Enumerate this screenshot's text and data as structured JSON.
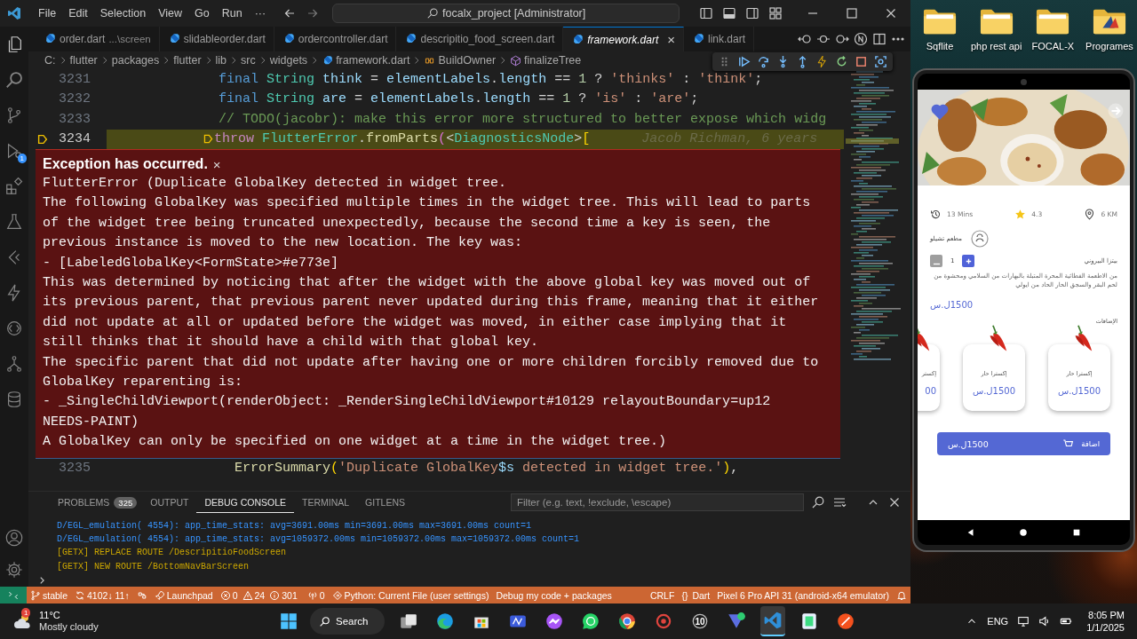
{
  "title_bar": {
    "menu": [
      "File",
      "Edit",
      "Selection",
      "View",
      "Go",
      "Run",
      "···"
    ],
    "command_center": "focalx_project [Administrator]"
  },
  "activity_bar": {
    "run_badge": "1"
  },
  "tabs": [
    {
      "label": "order.dart",
      "description": "...\\screen",
      "selected": false,
      "preview": false
    },
    {
      "label": "slidableorder.dart",
      "selected": false,
      "preview": false
    },
    {
      "label": "ordercontroller.dart",
      "selected": false,
      "preview": false
    },
    {
      "label": "descripitio_food_screen.dart",
      "selected": false,
      "preview": false
    },
    {
      "label": "framework.dart",
      "selected": true,
      "preview": true,
      "close": "×"
    },
    {
      "label": "link.dart",
      "selected": false,
      "preview": false
    }
  ],
  "breadcrumbs": [
    {
      "kind": "folder",
      "label": "C:"
    },
    {
      "kind": "folder",
      "label": "flutter"
    },
    {
      "kind": "folder",
      "label": "packages"
    },
    {
      "kind": "folder",
      "label": "flutter"
    },
    {
      "kind": "folder",
      "label": "lib"
    },
    {
      "kind": "folder",
      "label": "src"
    },
    {
      "kind": "folder",
      "label": "widgets"
    },
    {
      "kind": "file",
      "label": "framework.dart"
    },
    {
      "kind": "class",
      "label": "BuildOwner"
    },
    {
      "kind": "method",
      "label": "finalizeTree"
    }
  ],
  "editor": {
    "lines_before": [
      {
        "number": "3231",
        "current": false,
        "tokens": [
          {
            "kind": "kw",
            "text": "              final"
          },
          {
            "kind": "type",
            "text": " String"
          },
          {
            "kind": "var",
            "text": " think"
          },
          {
            "kind": "op",
            "text": " = "
          },
          {
            "kind": "var",
            "text": "elementLabels"
          },
          {
            "kind": "op",
            "text": "."
          },
          {
            "kind": "var",
            "text": "length"
          },
          {
            "kind": "op",
            "text": " == "
          },
          {
            "kind": "num",
            "text": "1"
          },
          {
            "kind": "op",
            "text": " ? "
          },
          {
            "kind": "str",
            "text": "'thinks'"
          },
          {
            "kind": "op",
            "text": " : "
          },
          {
            "kind": "str",
            "text": "'think'"
          },
          {
            "kind": "op",
            "text": ";"
          }
        ]
      },
      {
        "number": "3232",
        "current": false,
        "tokens": [
          {
            "kind": "kw",
            "text": "              final"
          },
          {
            "kind": "type",
            "text": " String"
          },
          {
            "kind": "var",
            "text": " are"
          },
          {
            "kind": "op",
            "text": " = "
          },
          {
            "kind": "var",
            "text": "elementLabels"
          },
          {
            "kind": "op",
            "text": "."
          },
          {
            "kind": "var",
            "text": "length"
          },
          {
            "kind": "op",
            "text": " == "
          },
          {
            "kind": "num",
            "text": "1"
          },
          {
            "kind": "op",
            "text": " ? "
          },
          {
            "kind": "str",
            "text": "'is'"
          },
          {
            "kind": "op",
            "text": " : "
          },
          {
            "kind": "str",
            "text": "'are'"
          },
          {
            "kind": "op",
            "text": ";"
          }
        ]
      },
      {
        "number": "3233",
        "current": false,
        "tokens": [
          {
            "kind": "comment",
            "text": "              // TODO(jacobr): make this error more structured to better expose which widg"
          }
        ]
      },
      {
        "number": "3234",
        "current": true,
        "blame": "Jacob Richman, 6 years",
        "tokens": [
          {
            "kind": "ctrl",
            "text": "            throw"
          },
          {
            "kind": "type",
            "text": " FlutterError"
          },
          {
            "kind": "op",
            "text": "."
          },
          {
            "kind": "fn",
            "text": "fromParts"
          },
          {
            "kind": "bracket2",
            "text": "("
          },
          {
            "kind": "op",
            "text": "<"
          },
          {
            "kind": "type",
            "text": "DiagnosticsNode"
          },
          {
            "kind": "op",
            "text": ">"
          },
          {
            "kind": "bracket",
            "text": "["
          }
        ]
      }
    ],
    "exception": {
      "title": "Exception has occurred.",
      "close": "×",
      "lines": [
        "FlutterError (Duplicate GlobalKey detected in widget tree.",
        "The following GlobalKey was specified multiple times in the widget tree. This will lead to parts",
        "of the widget tree being truncated unexpectedly, because the second time a key is seen, the",
        "previous instance is moved to the new location. The key was:",
        "- [LabeledGlobalKey<FormState>#e773e]",
        "This was determined by noticing that after the widget with the above global key was moved out of",
        "its previous parent, that previous parent never updated during this frame, meaning that it either",
        "did not update at all or updated before the widget was moved, in either case implying that it",
        "still thinks that it should have a child with that global key.",
        "The specific parent that did not update after having one or more children forcibly removed due to",
        "GlobalKey reparenting is:",
        "- _SingleChildViewport(renderObject: _RenderSingleChildViewport#10129 relayoutBoundary=up12",
        "NEEDS-PAINT)",
        "A GlobalKey can only be specified on one widget at a time in the widget tree.)"
      ]
    },
    "lines_after": [
      {
        "number": "3235",
        "current": false,
        "tokens": [
          {
            "kind": "fn",
            "text": "                ErrorSummary"
          },
          {
            "kind": "bracket",
            "text": "("
          },
          {
            "kind": "str",
            "text": "'Duplicate GlobalKey"
          },
          {
            "kind": "var",
            "text": "$s"
          },
          {
            "kind": "str",
            "text": " detected in widget tree.'"
          },
          {
            "kind": "bracket",
            "text": ")"
          },
          {
            "kind": "op",
            "text": ","
          }
        ]
      }
    ]
  },
  "panel": {
    "tabs": [
      {
        "label": "PROBLEMS",
        "badge": "325",
        "selected": false
      },
      {
        "label": "OUTPUT",
        "selected": false
      },
      {
        "label": "DEBUG CONSOLE",
        "selected": true
      },
      {
        "label": "TERMINAL",
        "selected": false
      },
      {
        "label": "GITLENS",
        "selected": false
      }
    ],
    "filter": {
      "placeholder": "Filter (e.g. text, !exclude, \\escape)"
    },
    "console": [
      {
        "kind": "log",
        "text": "D/EGL_emulation( 4554): app_time_stats: avg=3691.00ms min=3691.00ms max=3691.00ms count=1"
      },
      {
        "kind": "log",
        "text": "D/EGL_emulation( 4554): app_time_stats: avg=1059372.00ms min=1059372.00ms max=1059372.00ms count=1"
      },
      {
        "kind": "route",
        "text": "[GETX] REPLACE ROUTE /DescripitioFoodScreen"
      },
      {
        "kind": "route",
        "text": "[GETX] NEW ROUTE /BottomNavBarScreen"
      }
    ]
  },
  "status_bar": {
    "left": [
      {
        "kind": "remote"
      },
      {
        "kind": "branch",
        "text": "stable"
      },
      {
        "kind": "sync",
        "text": "4102↓ 11↑"
      },
      {
        "kind": "devtools"
      },
      {
        "kind": "launchpad",
        "text": "Launchpad"
      },
      {
        "kind": "problems",
        "errors": "0",
        "warnings": "24",
        "infos": "301"
      },
      {
        "kind": "ports",
        "text": "0"
      },
      {
        "kind": "python",
        "text": "Python: Current File (user settings)"
      },
      {
        "kind": "plain",
        "text": "Debug my code + packages"
      }
    ],
    "right": [
      {
        "kind": "plain",
        "text": "CRLF"
      },
      {
        "kind": "language",
        "icon": "{}",
        "text": "Dart"
      },
      {
        "kind": "plain",
        "text": "Pixel 6 Pro API 31 (android-x64 emulator)"
      },
      {
        "kind": "bell"
      }
    ]
  },
  "desktop": {
    "icons": [
      {
        "kind": "folder",
        "label": "Sqflite"
      },
      {
        "kind": "folder",
        "label": "php rest api"
      },
      {
        "kind": "folder",
        "label": "FOCAL-X"
      },
      {
        "kind": "app_folder",
        "label": "Programes"
      }
    ]
  },
  "phone": {
    "favorite": true,
    "stats": [
      {
        "kind": "time",
        "text": "13 Mins"
      },
      {
        "kind": "rating",
        "text": "4.3"
      },
      {
        "kind": "distance",
        "text": "6 KM"
      }
    ],
    "restaurant": "مطعم تشيلو",
    "quantity": "1",
    "product": "بيتزا البيروني",
    "description": "من الاطعمة الفطائية المحرة المتبلة بالبهارات من السلامي ومحشوة من لحم البقر والسجق الحار الحاد من ايولي",
    "price": "1500ل.س",
    "additions_title": "الإضافات",
    "additions": [
      {
        "name": "إكسترا حار",
        "price": "1500ل.س",
        "partial": false
      },
      {
        "name": "إكسترا حار",
        "price": "1500ل.س",
        "partial": false
      },
      {
        "name": "إكستر",
        "price": "00",
        "partial": true
      }
    ],
    "add_button": {
      "label": "اضافة",
      "price": "1500ل.س"
    }
  },
  "taskbar": {
    "weather": {
      "badge": "1",
      "temperature": "11°C",
      "condition": "Mostly cloudy"
    },
    "search": "Search",
    "apps": [
      {
        "kind": "taskview",
        "selected": false
      },
      {
        "kind": "edge",
        "selected": false
      },
      {
        "kind": "store",
        "selected": false
      },
      {
        "kind": "tiles",
        "selected": false
      },
      {
        "kind": "messenger",
        "selected": false
      },
      {
        "kind": "chat",
        "selected": false
      },
      {
        "kind": "chrome",
        "selected": false
      },
      {
        "kind": "target",
        "selected": false
      },
      {
        "kind": "numbered",
        "badge": "10",
        "selected": false
      },
      {
        "kind": "check",
        "selected": false
      },
      {
        "kind": "vscode",
        "selected": true
      },
      {
        "kind": "studio",
        "selected": false
      },
      {
        "kind": "brush",
        "selected": false
      }
    ],
    "tray": {
      "language": "ENG",
      "time": "8:05 PM",
      "date": "1/1/2025"
    }
  }
}
